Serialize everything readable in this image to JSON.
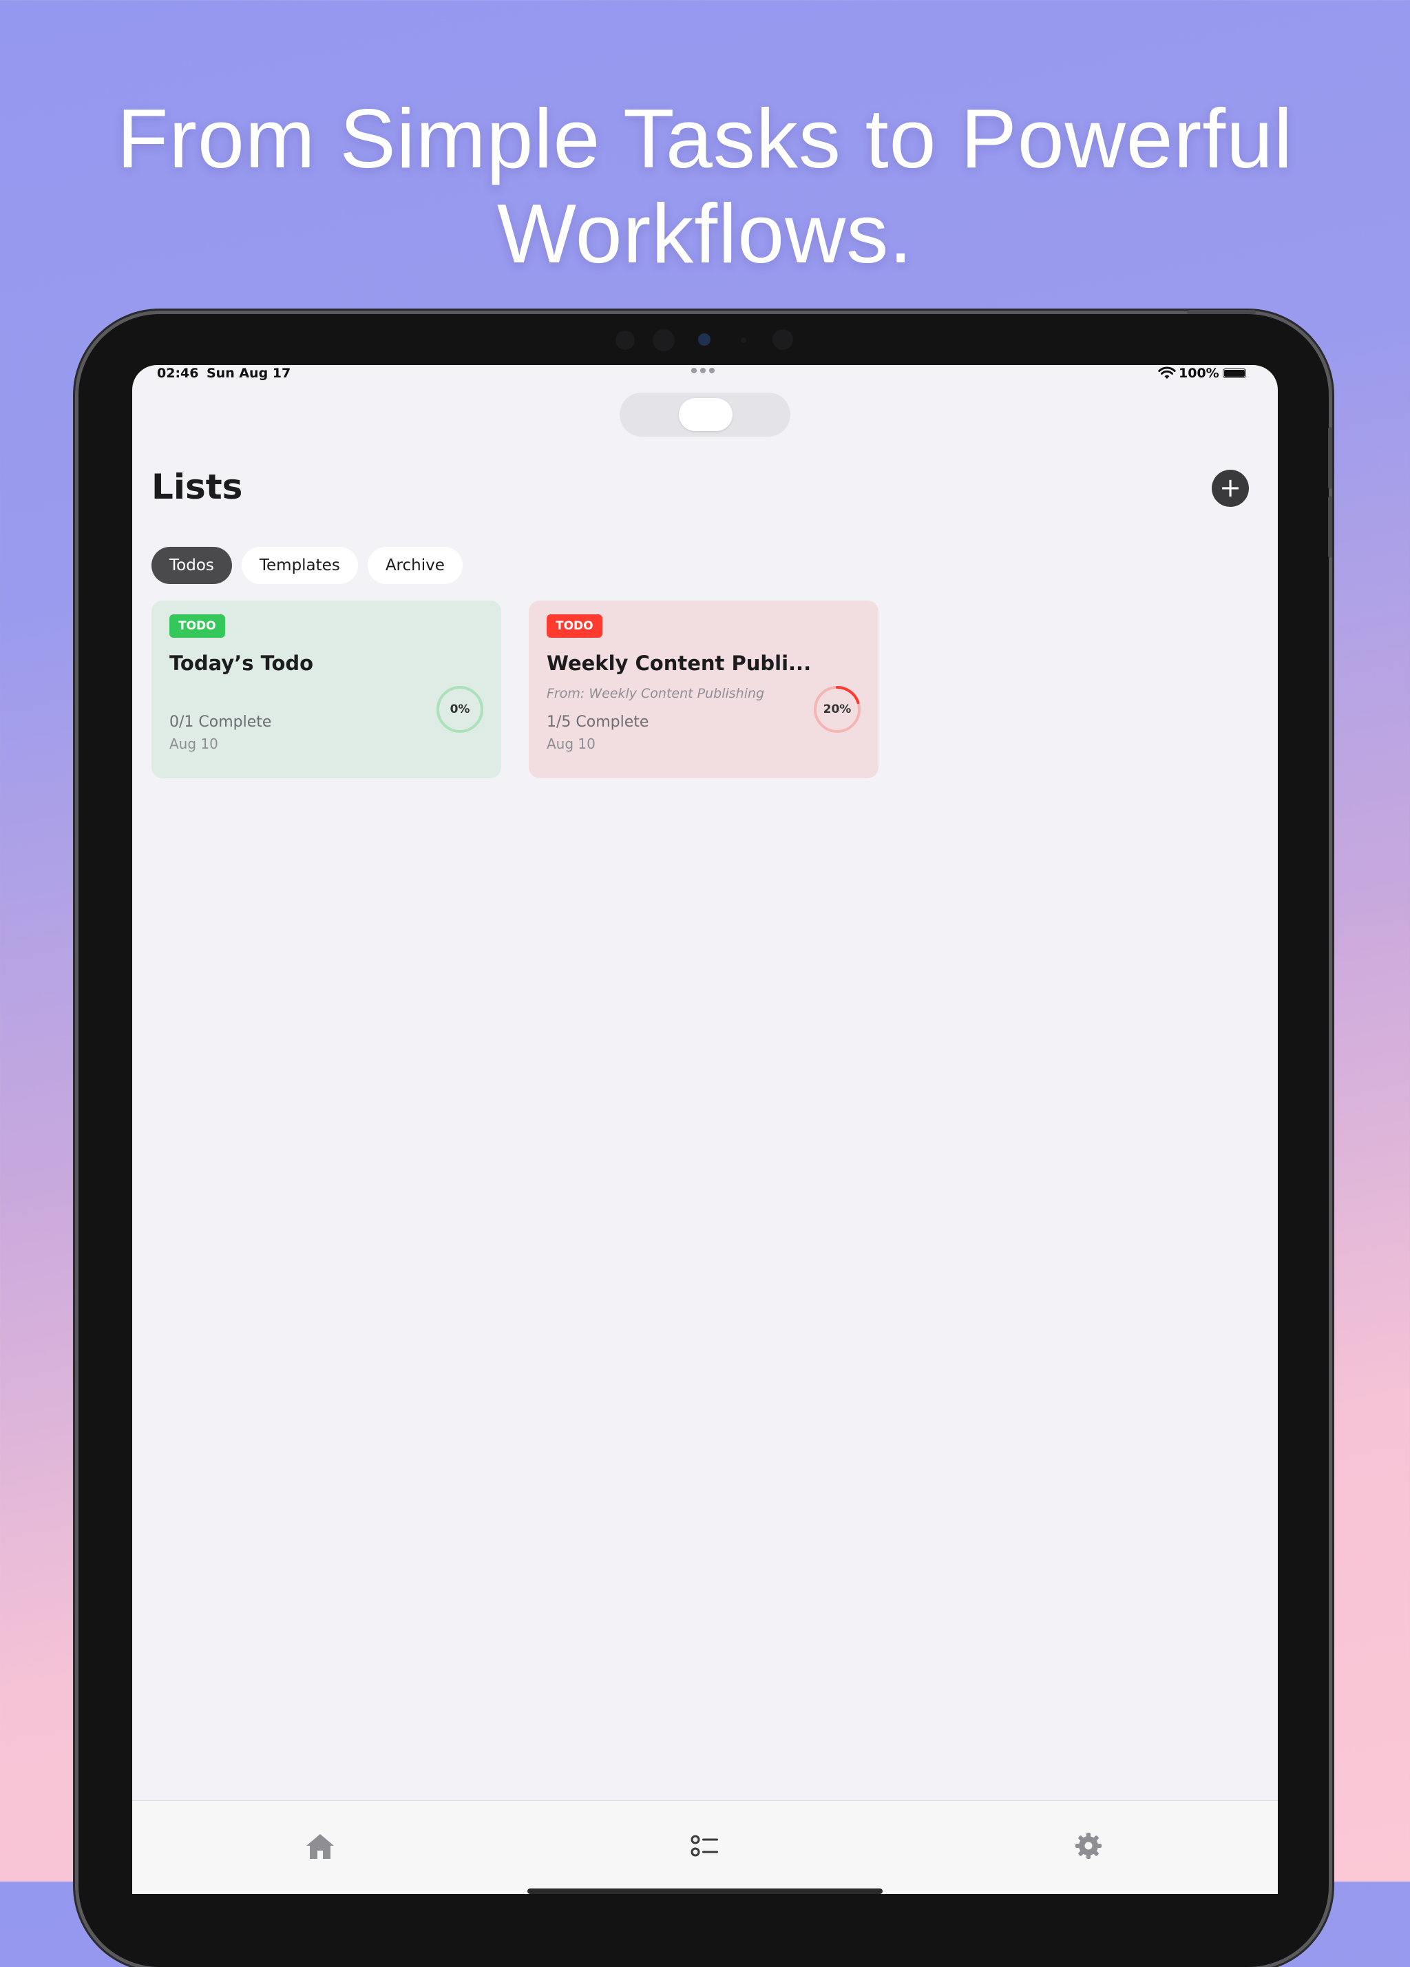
{
  "headline": {
    "line1": "From Simple Tasks to Powerful",
    "line2": "Workflows."
  },
  "status_bar": {
    "time": "02:46",
    "date": "Sun Aug 17",
    "battery": "100%"
  },
  "header": {
    "title": "Lists",
    "add_icon": "plus-icon"
  },
  "tabs": [
    {
      "label": "Todos",
      "selected": true
    },
    {
      "label": "Templates",
      "selected": false
    },
    {
      "label": "Archive",
      "selected": false
    }
  ],
  "cards": [
    {
      "badge": "TODO",
      "title": "Today’s Todo",
      "source": "",
      "progress_text": "0/1 Complete",
      "date": "Aug 10",
      "percent_label": "0%",
      "percent": 0,
      "accent": "#34c759"
    },
    {
      "badge": "TODO",
      "title": "Weekly Content Publi...",
      "source": "From: Weekly Content Publishing",
      "progress_text": "1/5 Complete",
      "date": "Aug 10",
      "percent_label": "20%",
      "percent": 20,
      "accent": "#ff3b30"
    }
  ],
  "tab_bar": {
    "items": [
      "home-icon",
      "list-icon",
      "gear-icon"
    ]
  },
  "colors": {
    "accent_green": "#34c759",
    "accent_red": "#ff3b30",
    "screen_bg": "#f2f2f7",
    "tab_selected": "#4a4a4c"
  }
}
